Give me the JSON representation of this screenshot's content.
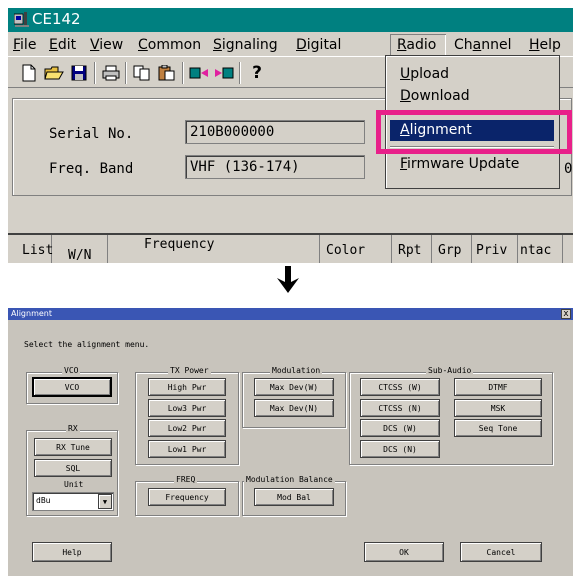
{
  "top_window": {
    "title": "CE142",
    "menu": [
      {
        "id": "file",
        "pre": "",
        "u": "F",
        "post": "ile"
      },
      {
        "id": "edit",
        "pre": "",
        "u": "E",
        "post": "dit"
      },
      {
        "id": "view",
        "pre": "",
        "u": "V",
        "post": "iew"
      },
      {
        "id": "common",
        "pre": "",
        "u": "C",
        "post": "ommon"
      },
      {
        "id": "signaling",
        "pre": "",
        "u": "S",
        "post": "ignaling"
      },
      {
        "id": "digital",
        "pre": "",
        "u": "D",
        "post": "igital"
      },
      {
        "id": "radio",
        "pre": "",
        "u": "R",
        "post": "adio"
      },
      {
        "id": "channel",
        "pre": "Ch",
        "u": "a",
        "post": "nnel"
      },
      {
        "id": "help",
        "pre": "",
        "u": "H",
        "post": "elp"
      }
    ],
    "toolbar_icons": [
      "new-file-icon",
      "open-folder-icon",
      "save-icon",
      "print-icon",
      "copy-icon",
      "paste-icon",
      "read-radio-icon",
      "write-radio-icon",
      "help-icon"
    ],
    "serial_label": "Serial No.",
    "serial_value": "210B000000",
    "band_label": "Freq. Band",
    "band_value": "VHF (136-174)",
    "clipped_value": "0",
    "grid_headers": {
      "list": "List",
      "wn": "W/N",
      "frequency": "Frequency",
      "color": "Color",
      "rpt": "Rpt",
      "grp": "Grp",
      "priv": "Priv",
      "ntac": "ntac"
    }
  },
  "radio_menu": {
    "upload": {
      "u": "U",
      "post": "pload"
    },
    "download": {
      "u": "D",
      "post": "ownload"
    },
    "alignment": {
      "u": "A",
      "post": "lignment"
    },
    "firmware": {
      "u": "F",
      "post": "irmware Update"
    }
  },
  "dialog": {
    "title": "Alignment",
    "close_label": "x",
    "instruction": "Select the alignment menu.",
    "groups": {
      "vco": "VCO",
      "tx_power": "TX Power",
      "modulation": "Modulation",
      "sub_audio": "Sub-Audio",
      "rx": "RX",
      "freq": "FREQ",
      "mod_balance": "Modulation Balance"
    },
    "buttons": {
      "vco": "VCO",
      "high_pwr": "High Pwr",
      "low3_pwr": "Low3 Pwr",
      "low2_pwr": "Low2 Pwr",
      "low1_pwr": "Low1 Pwr",
      "max_dev_w": "Max Dev(W)",
      "max_dev_n": "Max Dev(N)",
      "ctcss_w": "CTCSS (W)",
      "ctcss_n": "CTCSS (N)",
      "dcs_w": "DCS (W)",
      "dcs_n": "DCS (N)",
      "dtmf": "DTMF",
      "msk": "MSK",
      "seq_tone": "Seq Tone",
      "rx_tune": "RX Tune",
      "sql": "SQL",
      "frequency": "Frequency",
      "mod_bal": "Mod Bal",
      "help": "Help",
      "ok": "OK",
      "cancel": "Cancel"
    },
    "unit_label": "Unit",
    "unit_value": "dBu"
  }
}
